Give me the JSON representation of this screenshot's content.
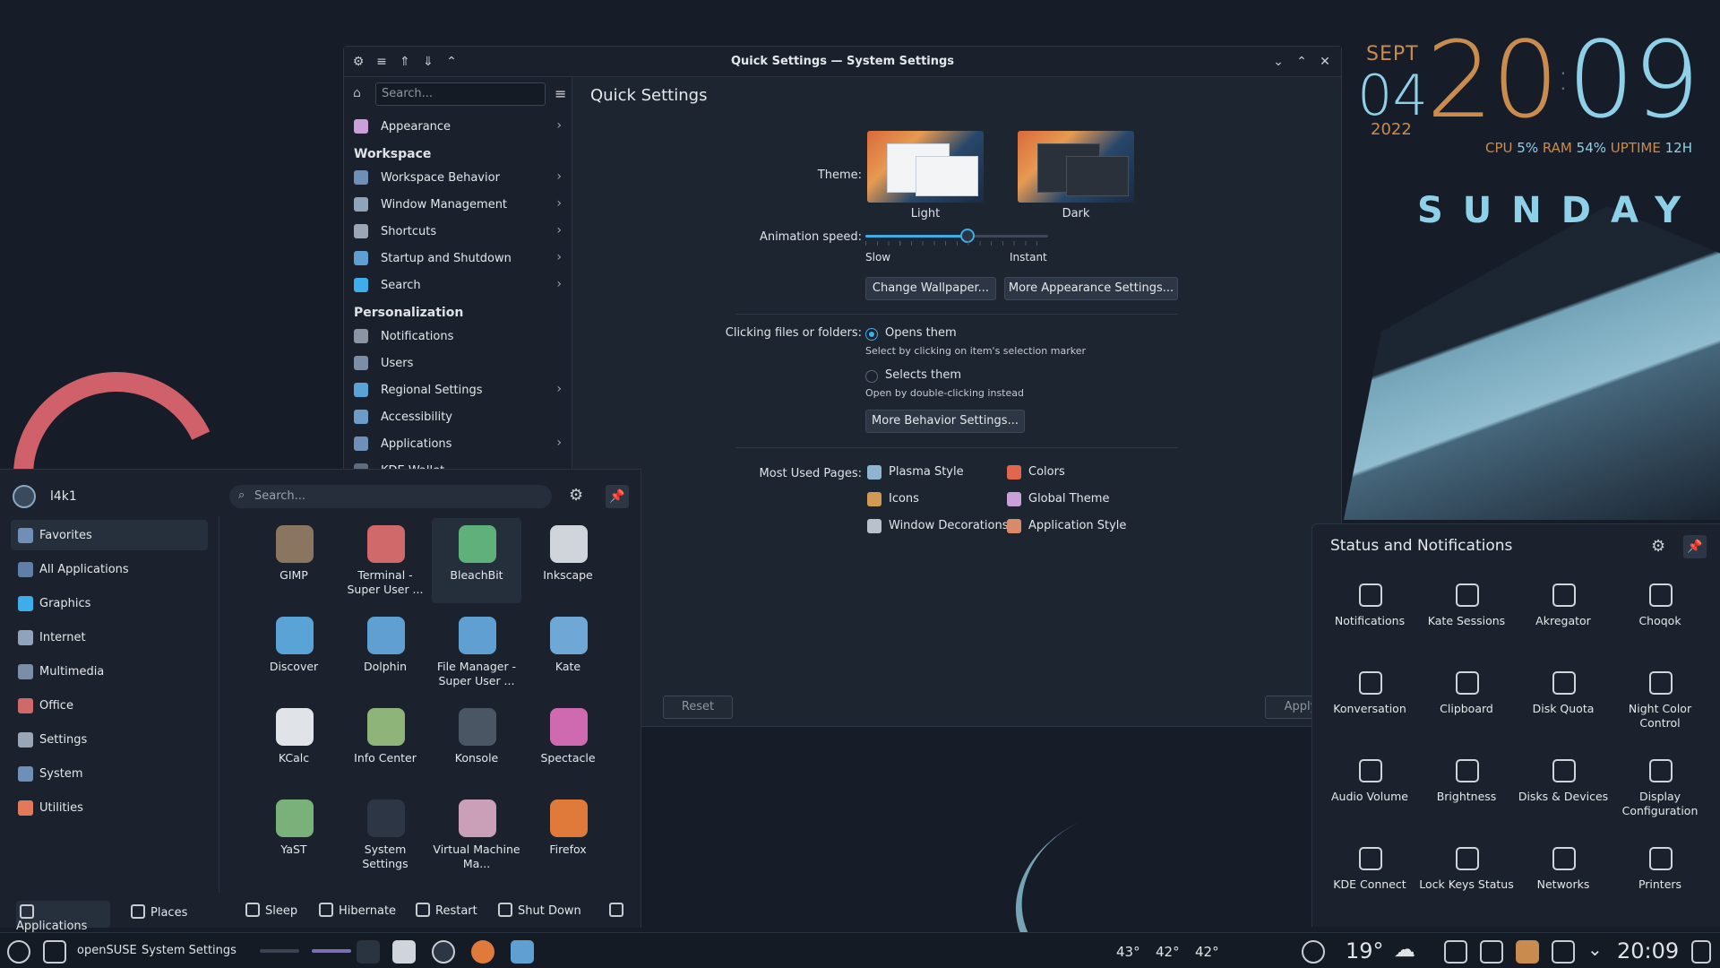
{
  "clock": {
    "month": "SEPT",
    "day": "04",
    "year": "2022",
    "hours": "20",
    "minutes": "09",
    "stats": {
      "cpu_label": "CPU",
      "cpu": "5%",
      "ram_label": "RAM",
      "ram": "54%",
      "uptime_label": "UPTIME",
      "uptime": "12H"
    },
    "dayname": "SUNDAY"
  },
  "window": {
    "title": "Quick Settings — System Settings",
    "search_placeholder": "Search...",
    "sidebar": {
      "top": [
        {
          "label": "Appearance",
          "color": "#c9a0d8",
          "chevron": "›"
        }
      ],
      "workspace_header": "Workspace",
      "workspace": [
        {
          "label": "Workspace Behavior",
          "color": "#6f8fb8",
          "chevron": "›"
        },
        {
          "label": "Window Management",
          "color": "#8fa3ba",
          "chevron": "›"
        },
        {
          "label": "Shortcuts",
          "color": "#9aa6b5",
          "chevron": "›"
        },
        {
          "label": "Startup and Shutdown",
          "color": "#5f9fd1",
          "chevron": "›"
        },
        {
          "label": "Search",
          "color": "#3daee9",
          "chevron": "›"
        }
      ],
      "personalization_header": "Personalization",
      "personalization": [
        {
          "label": "Notifications",
          "color": "#8c95a3",
          "chevron": ""
        },
        {
          "label": "Users",
          "color": "#7a8ea8",
          "chevron": ""
        },
        {
          "label": "Regional Settings",
          "color": "#5aa3d6",
          "chevron": "›"
        },
        {
          "label": "Accessibility",
          "color": "#6f9bc7",
          "chevron": ""
        },
        {
          "label": "Applications",
          "color": "#6f8fb8",
          "chevron": "›"
        },
        {
          "label": "KDE Wallet",
          "color": "#5f6c7d",
          "chevron": ""
        }
      ]
    },
    "main_title": "Quick Settings",
    "theme_label": "Theme:",
    "theme_light": "Light",
    "theme_dark": "Dark",
    "animation_label": "Animation speed:",
    "animation_slow": "Slow",
    "animation_instant": "Instant",
    "animation_value": 0.56,
    "change_wallpaper": "Change Wallpaper...",
    "more_appearance": "More Appearance Settings...",
    "clicking_label": "Clicking files or folders:",
    "opens_them": "Opens them",
    "opens_note": "Select by clicking on item's selection marker",
    "selects_them": "Selects them",
    "selects_note": "Open by double-clicking instead",
    "more_behavior": "More Behavior Settings...",
    "most_used_label": "Most Used Pages:",
    "most_used": [
      {
        "label": "Plasma Style",
        "color": "#8fb4d0"
      },
      {
        "label": "Colors",
        "color": "#e0664f"
      },
      {
        "label": "Icons",
        "color": "#d09a55"
      },
      {
        "label": "Global Theme",
        "color": "#c9a0d8"
      },
      {
        "label": "Window Decorations",
        "color": "#b8c1cc"
      },
      {
        "label": "Application Style",
        "color": "#d88a6a"
      }
    ],
    "reset": "Reset",
    "apply": "Apply"
  },
  "launcher": {
    "user": "l4k1",
    "search_placeholder": "Search...",
    "categories": [
      {
        "label": "Favorites",
        "color": "#6f8fb8"
      },
      {
        "label": "All Applications",
        "color": "#5f7fa8"
      },
      {
        "label": "Graphics",
        "color": "#3daee9"
      },
      {
        "label": "Internet",
        "color": "#8fa3ba"
      },
      {
        "label": "Multimedia",
        "color": "#7a8ea8"
      },
      {
        "label": "Office",
        "color": "#d06a6a"
      },
      {
        "label": "Settings",
        "color": "#9aa6b5"
      },
      {
        "label": "System",
        "color": "#6f8fb8"
      },
      {
        "label": "Utilities",
        "color": "#e07a5a"
      }
    ],
    "apps": [
      {
        "label": "GIMP",
        "color": "#8a7560"
      },
      {
        "label": "Terminal - Super User ...",
        "color": "#d06a6a"
      },
      {
        "label": "BleachBit",
        "color": "#5fb07a"
      },
      {
        "label": "Inkscape",
        "color": "#cfd5db"
      },
      {
        "label": "Discover",
        "color": "#5aa3d6"
      },
      {
        "label": "Dolphin",
        "color": "#5f9fd1"
      },
      {
        "label": "File Manager - Super User ...",
        "color": "#5f9fd1"
      },
      {
        "label": "Kate",
        "color": "#6fa8d6"
      },
      {
        "label": "KCalc",
        "color": "#e0e4e8"
      },
      {
        "label": "Info Center",
        "color": "#8fb47a"
      },
      {
        "label": "Konsole",
        "color": "#4a5664"
      },
      {
        "label": "Spectacle",
        "color": "#d06ab0"
      },
      {
        "label": "YaST",
        "color": "#7ab07a"
      },
      {
        "label": "System Settings",
        "color": "#2d3644"
      },
      {
        "label": "Virtual Machine Ma...",
        "color": "#c9a0b8"
      },
      {
        "label": "Firefox",
        "color": "#e07a3a"
      }
    ],
    "footer": {
      "applications": "Applications",
      "places": "Places",
      "sleep": "Sleep",
      "hibernate": "Hibernate",
      "restart": "Restart",
      "shutdown": "Shut Down"
    }
  },
  "status": {
    "header": "Status and Notifications",
    "items": [
      "Notifications",
      "Kate Sessions",
      "Akregator",
      "Choqok",
      "Konversation",
      "Clipboard",
      "Disk Quota",
      "Night Color Control",
      "Audio Volume",
      "Brightness",
      "Disks & Devices",
      "Display Configuration",
      "KDE Connect",
      "Lock Keys Status",
      "Networks",
      "Printers"
    ]
  },
  "taskbar": {
    "app1": "openSUSE",
    "app2": "System Settings",
    "temp1": "43°",
    "temp2": "42°",
    "temp3": "42°",
    "weather": "19°",
    "time": "20:09"
  }
}
